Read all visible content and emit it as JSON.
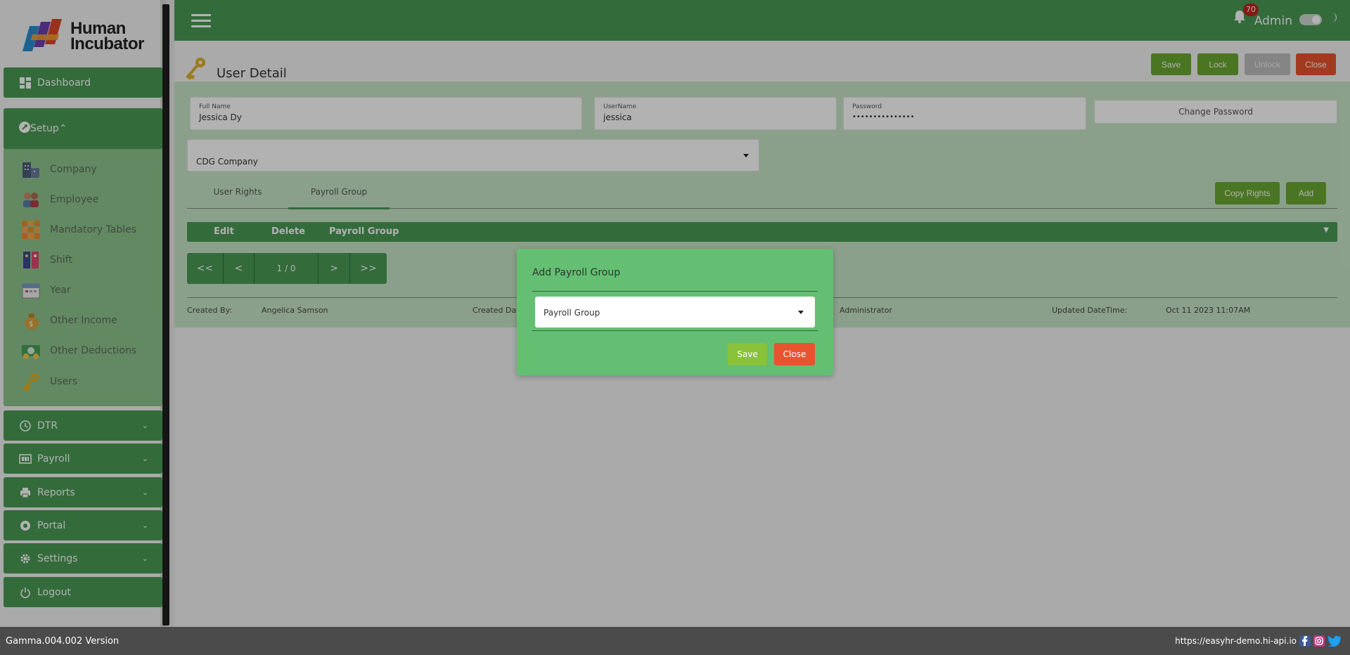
{
  "app": {
    "logo_line1": "Human",
    "logo_line2": "Incubator"
  },
  "sidebar": {
    "dashboard": "Dashboard",
    "setup": "Setup",
    "setup_items": [
      {
        "label": "Company"
      },
      {
        "label": "Employee"
      },
      {
        "label": "Mandatory Tables"
      },
      {
        "label": "Shift"
      },
      {
        "label": "Year"
      },
      {
        "label": "Other Income"
      },
      {
        "label": "Other Deductions"
      },
      {
        "label": "Users"
      }
    ],
    "dtr": "DTR",
    "payroll": "Payroll",
    "reports": "Reports",
    "portal": "Portal",
    "settings": "Settings",
    "logout": "Logout"
  },
  "header": {
    "notification_count": "70",
    "user": "Admin"
  },
  "page": {
    "title": "User Detail",
    "buttons": {
      "save": "Save",
      "lock": "Lock",
      "unlock": "Unlock",
      "close": "Close"
    },
    "fields": {
      "full_name_label": "Full Name",
      "full_name": "Jessica Dy",
      "username_label": "UserName",
      "username": "jessica",
      "password_label": "Password",
      "password": "•••••••••••••••",
      "change_password": "Change Password",
      "company": "CDG Company"
    },
    "tabs": {
      "user_rights": "User Rights",
      "payroll_group": "Payroll Group"
    },
    "actions": {
      "copy_rights": "Copy Rights",
      "add": "Add"
    },
    "grid": {
      "columns": [
        "Edit",
        "Delete",
        "Payroll Group"
      ]
    },
    "pager": {
      "first": "<<",
      "prev": "<",
      "page": "1 / 0",
      "next": ">",
      "last": ">>"
    },
    "audit": {
      "created_by_label": "Created By:",
      "created_by": "Angelica Samson",
      "created_date_label": "Created Date",
      "updated_by": "Administrator",
      "updated_label": "Updated DateTime:",
      "updated_value": "Oct 11 2023 11:07AM"
    }
  },
  "modal": {
    "title": "Add Payroll Group",
    "select_value": "Payroll Group",
    "save": "Save",
    "close": "Close"
  },
  "footer": {
    "version": "Gamma.004.002 Version",
    "url": "https://easyhr-demo.hi-api.io"
  },
  "colors": {
    "primary": "#4a9a55",
    "save_green": "#6aa832",
    "close_red": "#e8542f"
  }
}
